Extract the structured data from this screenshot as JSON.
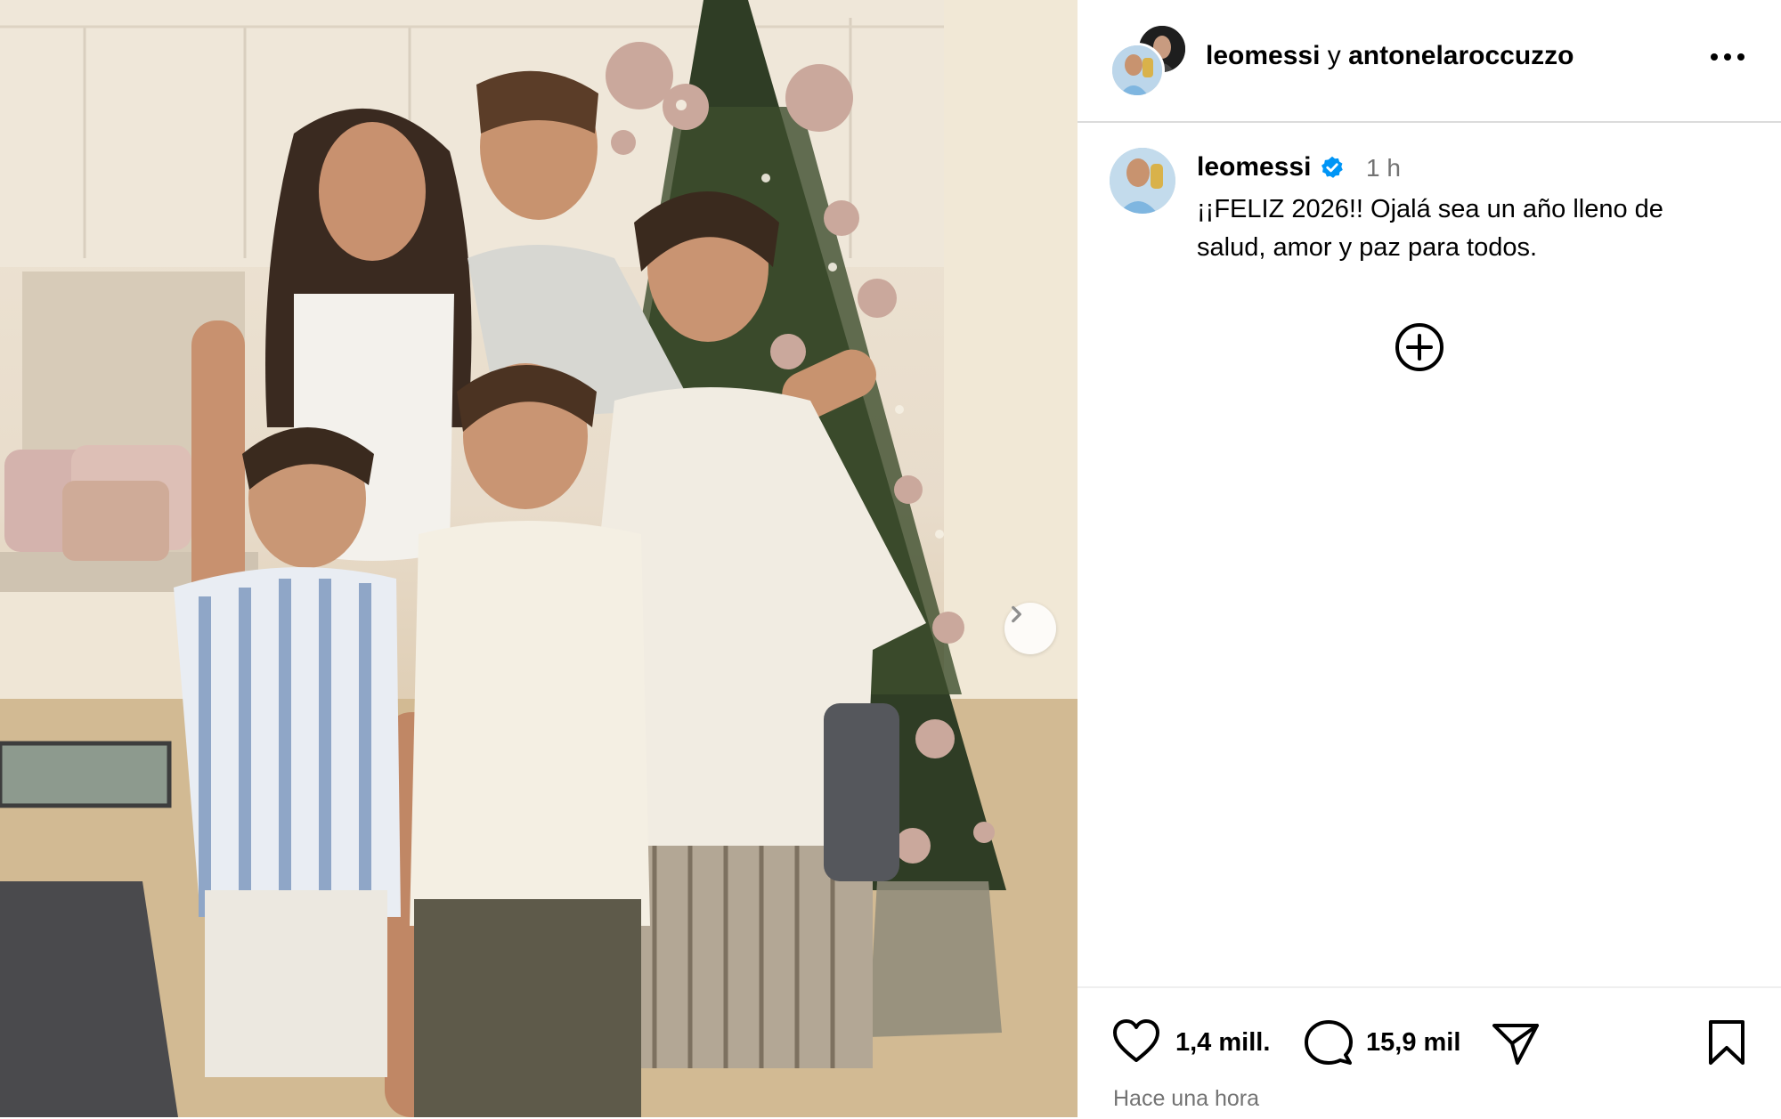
{
  "post": {
    "photo_alt": "",
    "carousel_next_icon": "chevron-right-icon"
  },
  "header": {
    "user1": "leomessi",
    "separator": "y",
    "user2": "antonelaroccuzzo",
    "more_icon": "more-horizontal-icon"
  },
  "caption": {
    "username": "leomessi",
    "verified_icon": "verified-badge-icon",
    "time": "1 h",
    "text": "¡¡FELIZ 2026!! Ojalá sea un año lleno de salud, amor y paz para todos.",
    "add_icon": "plus-circle-icon"
  },
  "actions": {
    "like_icon": "heart-icon",
    "likes": "1,4 mill.",
    "comment_icon": "comment-icon",
    "comments": "15,9 mil",
    "share_icon": "send-icon",
    "save_icon": "bookmark-icon",
    "timestamp": "Hace una hora"
  },
  "colors": {
    "verified": "#0095f6",
    "secondary_text": "#737373",
    "divider": "#dbdbdb"
  }
}
